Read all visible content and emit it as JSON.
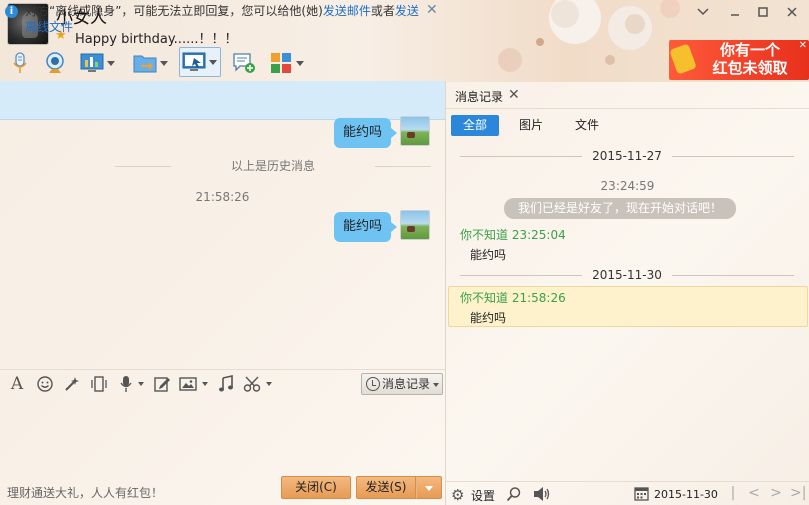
{
  "header": {
    "nickname": "小女人",
    "signature": "Happy birthday......！！！",
    "hongbao": "你有一个\n红包未领取"
  },
  "notice": {
    "text_before": "对方“离线或隐身”，可能无法立即回复，您可以给他(她)",
    "link1": "发送邮件",
    "text_mid": "或者",
    "link2": "发送离线文件"
  },
  "chat": {
    "messages": [
      {
        "text": "能约吗"
      },
      {
        "text": "能约吗"
      }
    ],
    "history_divider": "以上是历史消息",
    "time": "21:58:26"
  },
  "input": {
    "msg_record_label": "消息记录"
  },
  "footer": {
    "promo": "理财通送大礼，人人有红包！",
    "close_label": "关闭(C)",
    "send_label": "发送(S)"
  },
  "history_panel": {
    "tab_label": "消息记录",
    "filters": [
      "全部",
      "图片",
      "文件"
    ],
    "dates": [
      "2015-11-27",
      "2015-11-30"
    ],
    "time1": "23:24:59",
    "system_msg": "我们已经是好友了，现在开始对话吧！",
    "entries": [
      {
        "sender": "你不知道",
        "time": "23:25:04",
        "text": "能约吗"
      },
      {
        "sender": "你不知道",
        "time": "21:58:26",
        "text": "能约吗"
      }
    ],
    "settings_label": "设置",
    "date_value": "2015-11-30"
  },
  "colors": {
    "accent": "#2b87d9",
    "bubble": "#6fc3f3",
    "sender": "#3aa14a",
    "button": "#e79b55"
  }
}
